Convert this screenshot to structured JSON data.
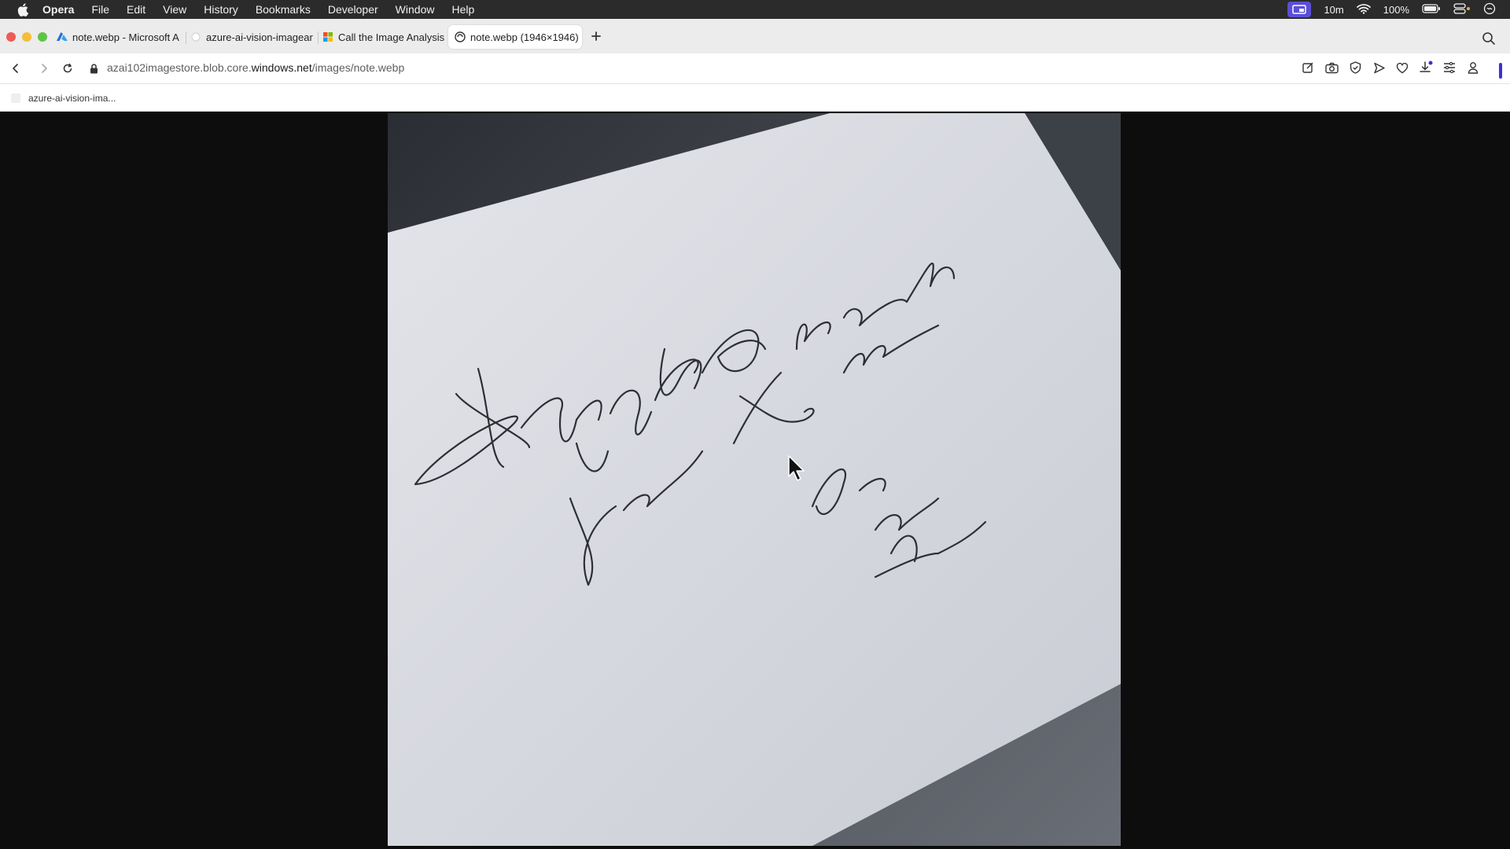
{
  "menubar": {
    "app": "Opera",
    "items": [
      "File",
      "Edit",
      "View",
      "History",
      "Bookmarks",
      "Developer",
      "Window",
      "Help"
    ],
    "time_remaining": "10m",
    "battery": "100%"
  },
  "tabs": [
    {
      "title": "note.webp - Microsoft A",
      "icon": "azure-icon"
    },
    {
      "title": "azure-ai-vision-imagear",
      "icon": "blank-page-icon"
    },
    {
      "title": "Call the Image Analysis",
      "icon": "microsoft-icon"
    },
    {
      "title": "note.webp (1946×1946)",
      "icon": "globe-icon",
      "active": true
    }
  ],
  "address": {
    "prefix": "azai102imagestore.blob.core.",
    "domain": "windows.net",
    "path": "/images/note.webp"
  },
  "bookmarks": [
    {
      "label": "azure-ai-vision-ima..."
    }
  ],
  "note": {
    "line1": "Happy Birthday!",
    "line2": "You're the best.",
    "line3": "love,",
    "line4": "Erin"
  },
  "colors": {
    "menubar": "#2b2b2b",
    "tabstrip": "#ececec",
    "accent": "#3b30d6",
    "paper": "#d9dbe2",
    "background": "#0d0d0d"
  }
}
